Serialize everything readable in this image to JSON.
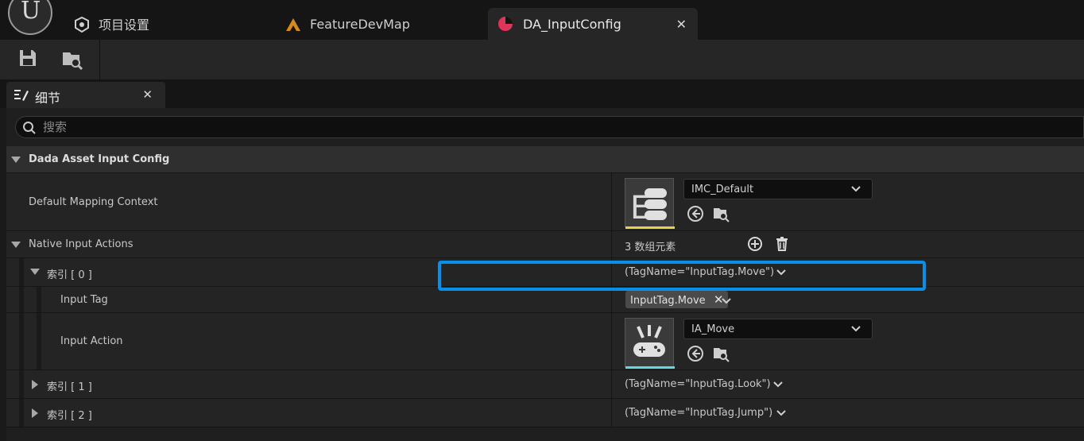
{
  "tabs": [
    {
      "label": "项目设置",
      "icon": "project-settings-icon"
    },
    {
      "label": "FeatureDevMap",
      "icon": "level-map-icon"
    },
    {
      "label": "DA_InputConfig",
      "icon": "data-asset-icon",
      "active": true
    }
  ],
  "toolbar": {
    "save_icon": "save-icon",
    "browse_icon": "browse-content-icon"
  },
  "details_tab": {
    "label": "细节",
    "icon": "details-icon"
  },
  "search": {
    "placeholder": "搜索"
  },
  "category": {
    "label": "Dada Asset Input Config"
  },
  "default_mapping": {
    "label": "Default Mapping Context",
    "value": "IMC_Default",
    "thumb_color": "#e8d24a"
  },
  "native_actions": {
    "label": "Native Input Actions",
    "count": "3 数组元素"
  },
  "items": [
    {
      "label": "索引 [ 0 ]",
      "value": "(TagName=\"InputTag.Move\")",
      "expanded": true
    },
    {
      "label": "索引 [ 1 ]",
      "value": "(TagName=\"InputTag.Look\")",
      "expanded": false
    },
    {
      "label": "索引 [ 2 ]",
      "value": "(TagName=\"InputTag.Jump\")",
      "expanded": false
    }
  ],
  "input_tag": {
    "label": "Input Tag",
    "value": "InputTag.Move"
  },
  "input_action": {
    "label": "Input Action",
    "value": "IA_Move",
    "thumb_color": "#5fd8e0"
  },
  "highlight_color": "#0a8fe8"
}
